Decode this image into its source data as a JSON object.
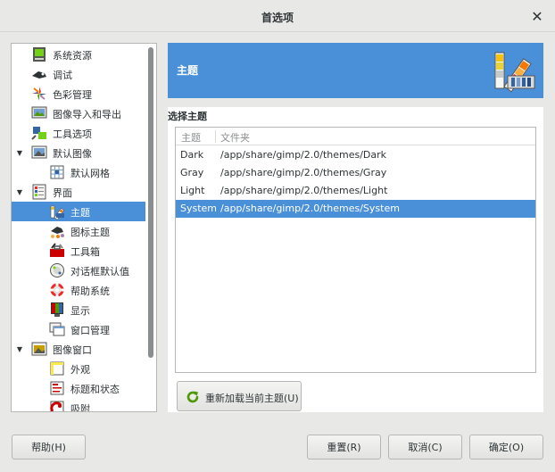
{
  "window": {
    "title": "首选项",
    "close_glyph": "✕"
  },
  "sidebar": {
    "items": [
      {
        "label": "系统资源",
        "icon": "system-resources-icon",
        "selected": false
      },
      {
        "label": "调试",
        "icon": "debug-icon",
        "selected": false
      },
      {
        "label": "色彩管理",
        "icon": "color-management-icon",
        "selected": false
      },
      {
        "label": "图像导入和导出",
        "icon": "image-import-export-icon",
        "selected": false
      },
      {
        "label": "工具选项",
        "icon": "tool-options-icon",
        "selected": false
      },
      {
        "label": "默认图像",
        "icon": "default-image-icon",
        "selected": false,
        "expanded": true
      },
      {
        "label": "默认网格",
        "icon": "default-grid-icon",
        "selected": false
      },
      {
        "label": "界面",
        "icon": "interface-icon",
        "selected": false,
        "expanded": true
      },
      {
        "label": "主题",
        "icon": "theme-icon",
        "selected": true
      },
      {
        "label": "图标主题",
        "icon": "icon-theme-icon",
        "selected": false
      },
      {
        "label": "工具箱",
        "icon": "toolbox-icon",
        "selected": false
      },
      {
        "label": "对话框默认值",
        "icon": "dialog-defaults-icon",
        "selected": false
      },
      {
        "label": "帮助系统",
        "icon": "help-system-icon",
        "selected": false
      },
      {
        "label": "显示",
        "icon": "display-icon",
        "selected": false
      },
      {
        "label": "窗口管理",
        "icon": "window-management-icon",
        "selected": false
      },
      {
        "label": "图像窗口",
        "icon": "image-windows-icon",
        "selected": false,
        "expanded": true
      },
      {
        "label": "外观",
        "icon": "appearance-icon",
        "selected": false
      },
      {
        "label": "标题和状态",
        "icon": "title-status-icon",
        "selected": false
      },
      {
        "label": "吸附",
        "icon": "snapping-icon",
        "selected": false
      }
    ]
  },
  "header": {
    "title": "主题",
    "icon": "theme-palette-icon"
  },
  "theme_section": {
    "label": "选择主题",
    "columns": [
      "主题",
      "文件夹"
    ],
    "rows": [
      {
        "name": "Dark",
        "path": "/app/share/gimp/2.0/themes/Dark"
      },
      {
        "name": "Gray",
        "path": "/app/share/gimp/2.0/themes/Gray"
      },
      {
        "name": "Light",
        "path": "/app/share/gimp/2.0/themes/Light"
      },
      {
        "name": "System",
        "path": "/app/share/gimp/2.0/themes/System"
      }
    ],
    "selected_row": "System",
    "reload_label": "重新加载当前主题(U)"
  },
  "footer": {
    "help": "帮助(H)",
    "reset": "重置(R)",
    "cancel": "取消(C)",
    "ok": "确定(O)"
  },
  "colors": {
    "accent": "#4a90d9",
    "background": "#e8e8e7"
  }
}
